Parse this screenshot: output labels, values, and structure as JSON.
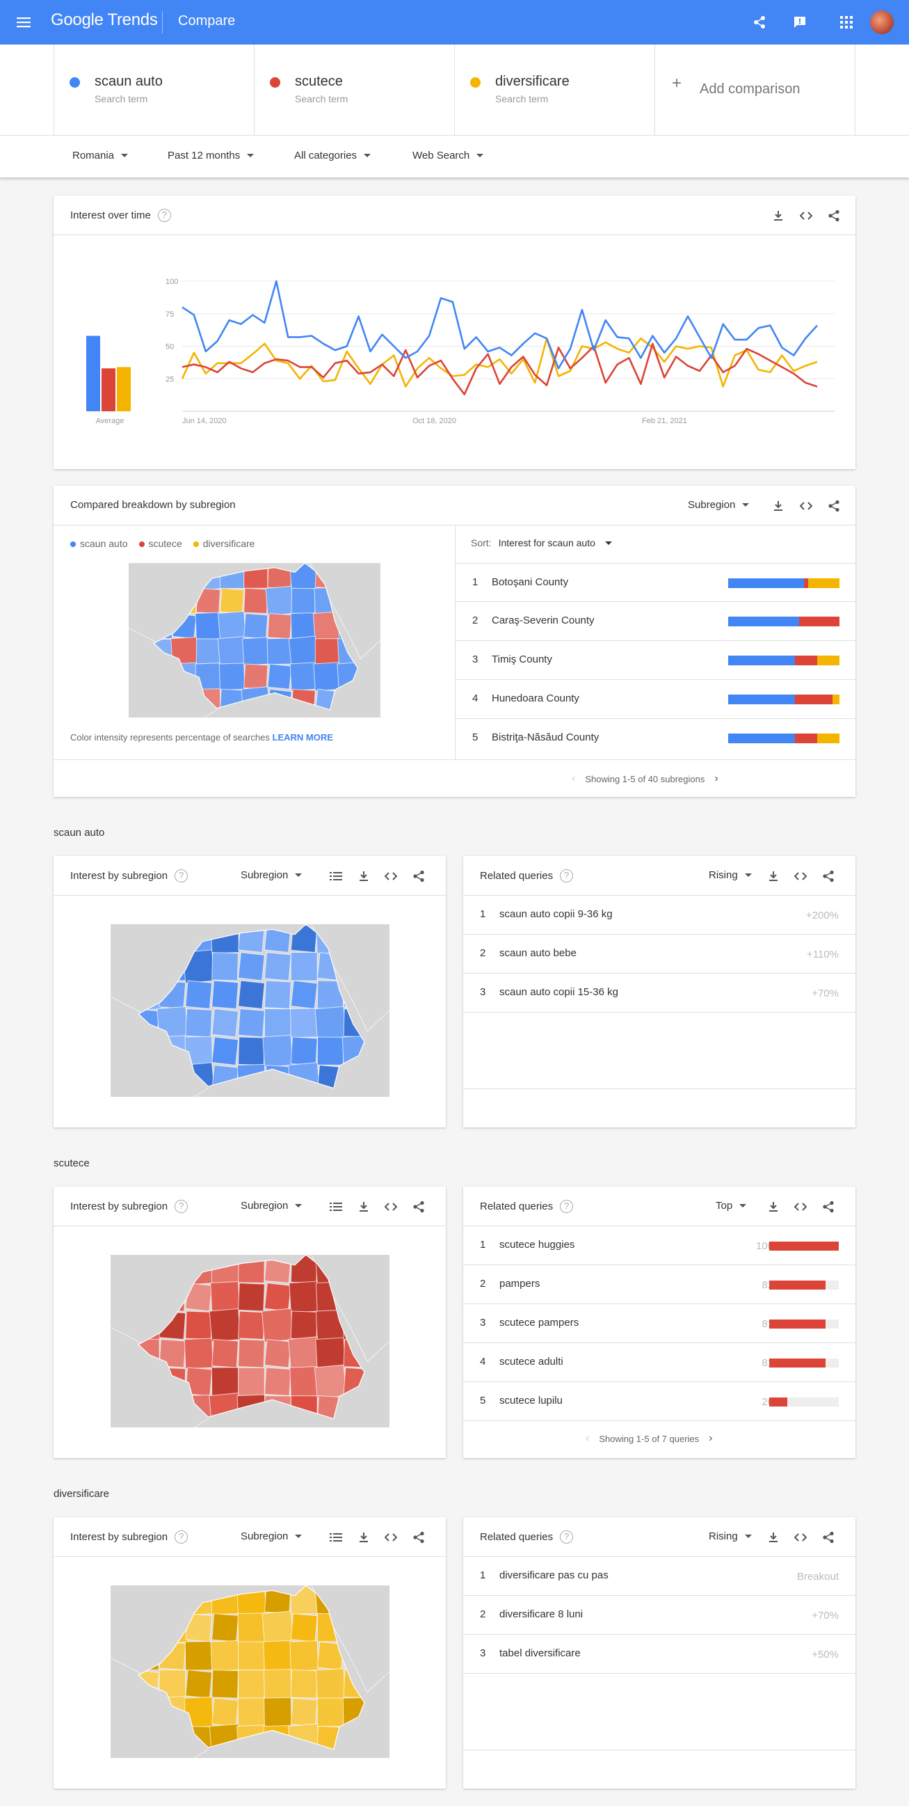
{
  "topbar": {
    "logo": "Google Trends",
    "page_title": "Compare"
  },
  "terms": [
    {
      "name": "scaun auto",
      "type": "Search term",
      "color": "#4285f4"
    },
    {
      "name": "scutece",
      "type": "Search term",
      "color": "#db4437"
    },
    {
      "name": "diversificare",
      "type": "Search term",
      "color": "#f4b400"
    }
  ],
  "add_comparison": "Add comparison",
  "filters": {
    "region": "Romania",
    "time": "Past 12 months",
    "category": "All categories",
    "search_type": "Web Search"
  },
  "interest_over_time": {
    "title": "Interest over time",
    "average_label": "Average",
    "chart_data": {
      "type": "line",
      "x_tick_labels": [
        "Jun 14, 2020",
        "Oct 18, 2020",
        "Feb 21, 2021"
      ],
      "y_ticks": [
        25,
        50,
        75,
        100
      ],
      "ylim": [
        0,
        100
      ],
      "averages": [
        58,
        33,
        34
      ],
      "series": [
        {
          "name": "scaun auto",
          "color": "#4285f4",
          "values": [
            80,
            74,
            46,
            54,
            70,
            67,
            74,
            68,
            100,
            57,
            57,
            58,
            52,
            47,
            50,
            73,
            46,
            59,
            50,
            41,
            46,
            58,
            87,
            84,
            48,
            57,
            46,
            49,
            43,
            52,
            60,
            56,
            33,
            48,
            78,
            47,
            70,
            57,
            56,
            41,
            58,
            45,
            56,
            73,
            57,
            41,
            67,
            55,
            55,
            64,
            66,
            49,
            43,
            56,
            66
          ]
        },
        {
          "name": "scutece",
          "color": "#db4437",
          "values": [
            34,
            36,
            34,
            30,
            38,
            33,
            30,
            37,
            40,
            39,
            34,
            34,
            26,
            37,
            39,
            29,
            30,
            36,
            27,
            47,
            26,
            35,
            39,
            25,
            13,
            33,
            44,
            21,
            34,
            42,
            28,
            20,
            49,
            33,
            41,
            50,
            22,
            36,
            41,
            21,
            52,
            26,
            42,
            35,
            31,
            43,
            30,
            35,
            48,
            44,
            39,
            34,
            29,
            22,
            19
          ]
        },
        {
          "name": "diversificare",
          "color": "#f4b400",
          "values": [
            25,
            45,
            29,
            37,
            37,
            37,
            44,
            52,
            39,
            37,
            25,
            35,
            23,
            24,
            46,
            33,
            21,
            36,
            43,
            19,
            33,
            41,
            33,
            27,
            28,
            36,
            34,
            40,
            29,
            40,
            22,
            56,
            27,
            31,
            50,
            48,
            53,
            48,
            45,
            56,
            49,
            38,
            50,
            48,
            50,
            49,
            19,
            43,
            47,
            32,
            30,
            43,
            31,
            35,
            38
          ]
        }
      ]
    }
  },
  "breakdown": {
    "title": "Compared breakdown by subregion",
    "dropdown": "Subregion",
    "legend": [
      "scaun auto",
      "scutece",
      "diversificare"
    ],
    "sort_label": "Sort:",
    "sort_value": "Interest for scaun auto",
    "note": "Color intensity represents percentage of searches",
    "learn_more": "LEARN MORE",
    "pagination": "Showing 1-5 of 40 subregions",
    "rows": [
      {
        "rank": "1",
        "name": "Botoşani County",
        "shares": [
          0.68,
          0.04,
          0.28
        ]
      },
      {
        "rank": "2",
        "name": "Caraş-Severin County",
        "shares": [
          0.64,
          0.36,
          0.0
        ]
      },
      {
        "rank": "3",
        "name": "Timiş County",
        "shares": [
          0.6,
          0.2,
          0.2
        ]
      },
      {
        "rank": "4",
        "name": "Hunedoara County",
        "shares": [
          0.6,
          0.34,
          0.06
        ]
      },
      {
        "rank": "5",
        "name": "Bistriţa-Năsăud County",
        "shares": [
          0.6,
          0.2,
          0.2
        ]
      }
    ]
  },
  "sections": [
    {
      "title": "scaun auto",
      "interest_title": "Interest by subregion",
      "dropdown": "Subregion",
      "map_color": "#4285f4",
      "related_title": "Related queries",
      "related_dropdown": "Rising",
      "queries": [
        {
          "rank": "1",
          "text": "scaun auto copii 9-36 kg",
          "value": "+200%"
        },
        {
          "rank": "2",
          "text": "scaun auto bebe",
          "value": "+110%"
        },
        {
          "rank": "3",
          "text": "scaun auto copii 15-36 kg",
          "value": "+70%"
        }
      ]
    },
    {
      "title": "scutece",
      "interest_title": "Interest by subregion",
      "dropdown": "Subregion",
      "map_color": "#db4437",
      "related_title": "Related queries",
      "related_dropdown": "Top",
      "queries": [
        {
          "rank": "1",
          "text": "scutece huggies",
          "value": "100",
          "bar": 1.0
        },
        {
          "rank": "2",
          "text": "pampers",
          "value": "81",
          "bar": 0.81
        },
        {
          "rank": "3",
          "text": "scutece pampers",
          "value": "81",
          "bar": 0.81
        },
        {
          "rank": "4",
          "text": "scutece adulti",
          "value": "81",
          "bar": 0.81
        },
        {
          "rank": "5",
          "text": "scutece lupilu",
          "value": "26",
          "bar": 0.26
        }
      ],
      "pagination": "Showing 1-5 of 7 queries"
    },
    {
      "title": "diversificare",
      "interest_title": "Interest by subregion",
      "dropdown": "Subregion",
      "map_color": "#f4b400",
      "related_title": "Related queries",
      "related_dropdown": "Rising",
      "queries": [
        {
          "rank": "1",
          "text": "diversificare pas cu pas",
          "value": "Breakout"
        },
        {
          "rank": "2",
          "text": "diversificare 8 luni",
          "value": "+70%"
        },
        {
          "rank": "3",
          "text": "tabel diversificare",
          "value": "+50%"
        }
      ]
    }
  ]
}
